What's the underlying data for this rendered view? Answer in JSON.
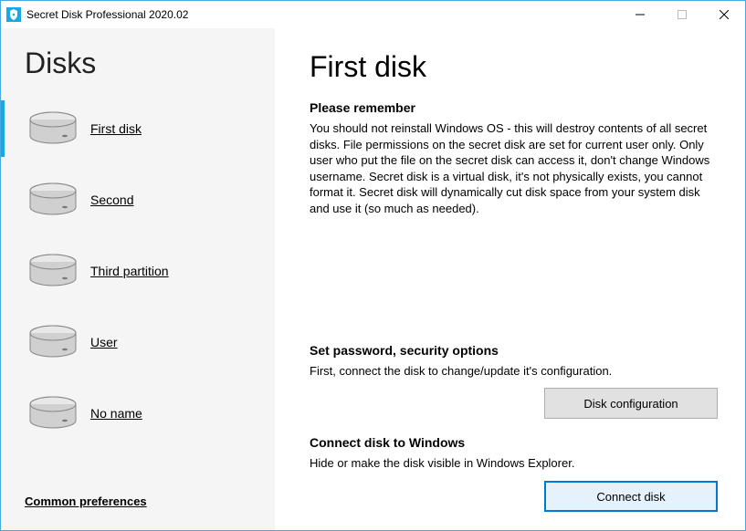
{
  "titlebar": {
    "title": "Secret Disk Professional 2020.02"
  },
  "sidebar": {
    "heading": "Disks",
    "items": [
      {
        "label": "First disk"
      },
      {
        "label": "Second"
      },
      {
        "label": "Third partition"
      },
      {
        "label": "User"
      },
      {
        "label": "No name"
      }
    ],
    "common_prefs": "Common preferences"
  },
  "main": {
    "heading": "First disk",
    "remember_heading": "Please remember",
    "remember_body": "You should not reinstall Windows OS - this will destroy contents of all secret disks. File permissions on the secret disk are set for current user only. Only user who put the file on the secret disk can access it, don't change Windows username. Secret disk is a virtual disk, it's not physically exists, you cannot format it. Secret disk will dynamically cut disk space from your system disk and use it (so much as needed).",
    "security_heading": "Set password, security options",
    "security_body": "First, connect the disk to change/update it's configuration.",
    "disk_config_btn": "Disk configuration",
    "connect_heading": "Connect disk to Windows",
    "connect_body": "Hide or make the disk visible in Windows Explorer.",
    "connect_btn": "Connect disk"
  }
}
